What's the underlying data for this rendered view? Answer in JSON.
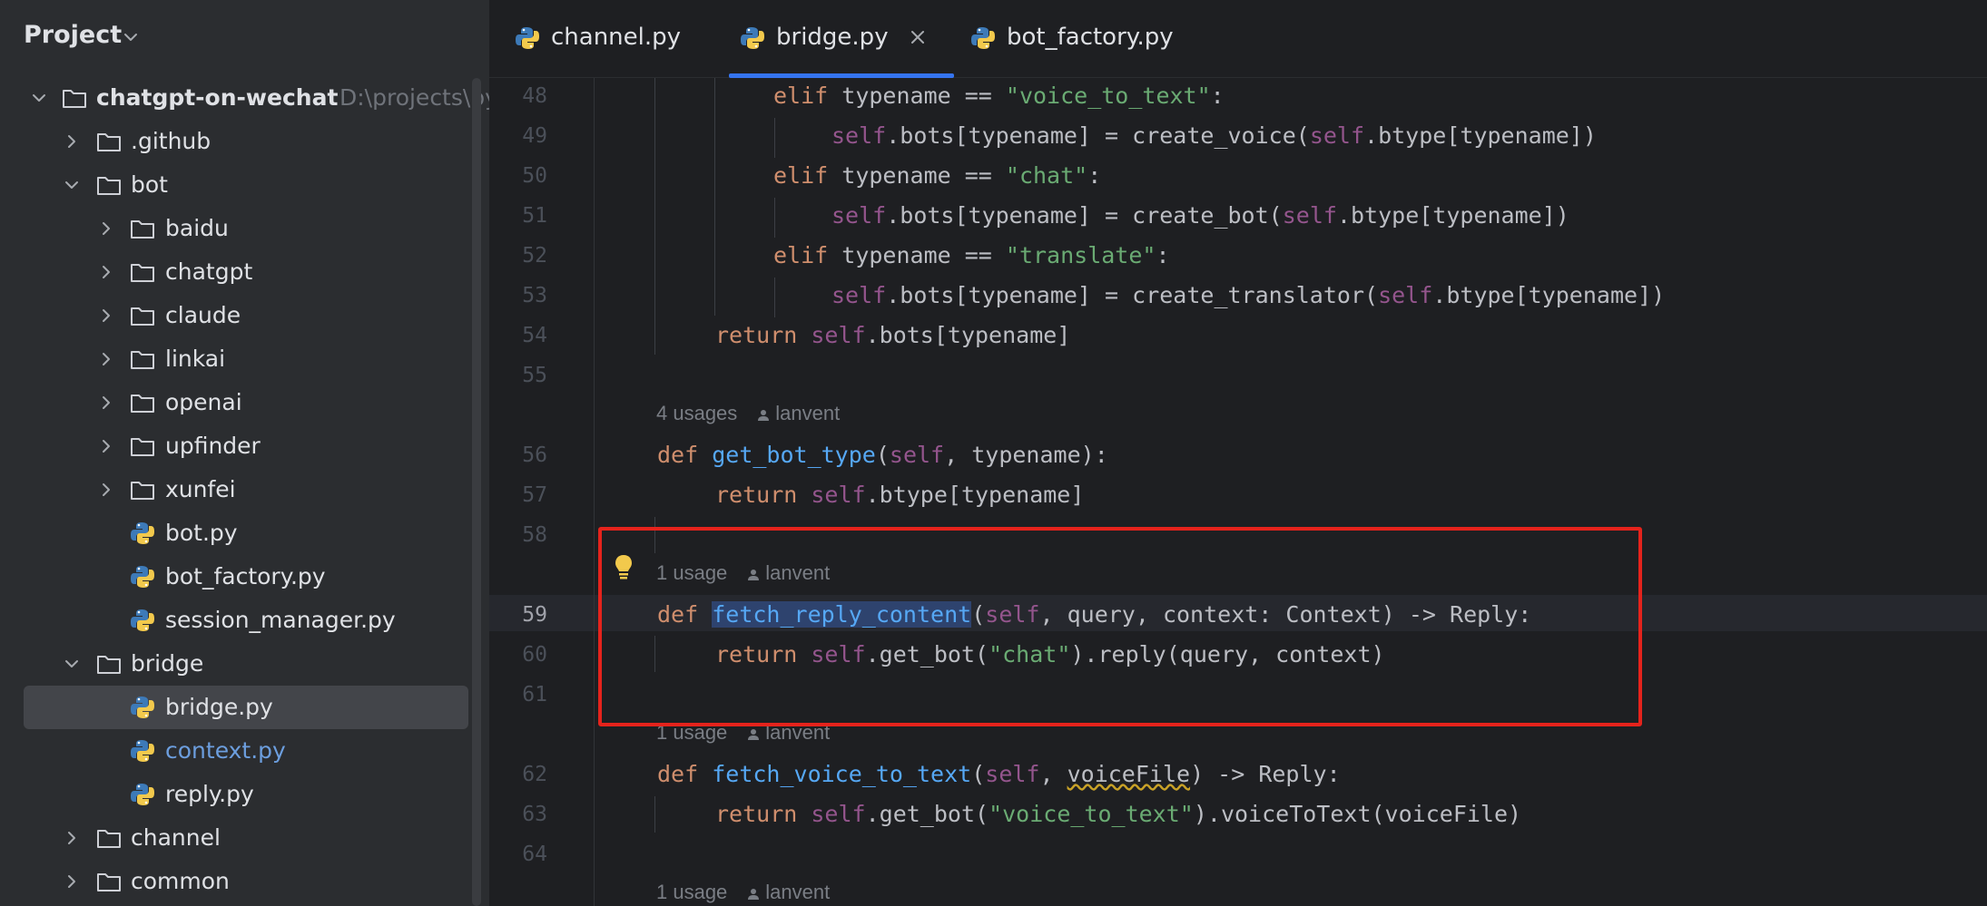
{
  "sidebar": {
    "title": "Project",
    "root": {
      "label": "chatgpt-on-wechat",
      "path": "D:\\projects\\py"
    },
    "items": [
      {
        "label": ".github"
      },
      {
        "label": "bot"
      },
      {
        "label": "baidu"
      },
      {
        "label": "chatgpt"
      },
      {
        "label": "claude"
      },
      {
        "label": "linkai"
      },
      {
        "label": "openai"
      },
      {
        "label": "upfinder"
      },
      {
        "label": "xunfei"
      },
      {
        "label": "bot.py"
      },
      {
        "label": "bot_factory.py"
      },
      {
        "label": "session_manager.py"
      },
      {
        "label": "bridge"
      },
      {
        "label": "bridge.py"
      },
      {
        "label": "context.py"
      },
      {
        "label": "reply.py"
      },
      {
        "label": "channel"
      },
      {
        "label": "common"
      }
    ]
  },
  "tabs": [
    {
      "label": "channel.py"
    },
    {
      "label": "bridge.py",
      "active": true
    },
    {
      "label": "bot_factory.py"
    }
  ],
  "editor": {
    "line_numbers": [
      "48",
      "49",
      "50",
      "51",
      "52",
      "53",
      "54",
      "55",
      "56",
      "57",
      "58",
      "59",
      "60",
      "61",
      "62",
      "63",
      "64"
    ],
    "current_line": "59",
    "code": {
      "l48": {
        "kw": "elif",
        "a": " typename == ",
        "s": "\"voice_to_text\"",
        "b": ":"
      },
      "l49": {
        "self1": "self",
        "a": ".bots[typename] = create_voice(",
        "self2": "self",
        "b": ".btype[typename])"
      },
      "l50": {
        "kw": "elif",
        "a": " typename == ",
        "s": "\"chat\"",
        "b": ":"
      },
      "l51": {
        "self1": "self",
        "a": ".bots[typename] = create_bot(",
        "self2": "self",
        "b": ".btype[typename])"
      },
      "l52": {
        "kw": "elif",
        "a": " typename == ",
        "s": "\"translate\"",
        "b": ":"
      },
      "l53": {
        "self1": "self",
        "a": ".bots[typename] = create_translator(",
        "self2": "self",
        "b": ".btype[typename])"
      },
      "l54": {
        "kw": "return",
        "self": "self",
        "b": ".bots[typename]"
      },
      "l56": {
        "kw": "def",
        "fn": "get_bot_type",
        "a": "(",
        "self": "self",
        "b": ", typename):"
      },
      "l57": {
        "kw": "return",
        "self": "self",
        "b": ".btype[typename]"
      },
      "l59": {
        "kw": "def",
        "fn": "fetch_reply_content",
        "a": "(",
        "self": "self",
        "b": ", query, context: Context) -> Reply:"
      },
      "l60": {
        "kw": "return",
        "self": "self",
        "a": ".get_bot(",
        "s": "\"chat\"",
        "b": ").reply(query, context)"
      },
      "l62": {
        "kw": "def",
        "fn": "fetch_voice_to_text",
        "a": "(",
        "self": "self",
        "b": ", ",
        "sq": "voiceFile",
        "c": ") -> Reply:"
      },
      "l63": {
        "kw": "return",
        "self": "self",
        "a": ".get_bot(",
        "s": "\"voice_to_text\"",
        "b": ").voiceToText(voiceFile)"
      }
    },
    "hints": [
      {
        "usages": "4 usages",
        "author": "lanvent"
      },
      {
        "usages": "1 usage",
        "author": "lanvent"
      },
      {
        "usages": "1 usage",
        "author": "lanvent"
      },
      {
        "usages": "1 usage",
        "author": "lanvent"
      }
    ]
  },
  "colors": {
    "accent": "#3574f0",
    "highlight_box": "#e5231c",
    "keyword": "#cf8e6d",
    "self": "#94558d",
    "string": "#6aab73",
    "function": "#56a8f5"
  },
  "icons": [
    "chevron-down-icon",
    "chevron-right-icon",
    "folder-icon",
    "python-file-icon",
    "close-icon",
    "lightbulb-icon",
    "person-icon"
  ]
}
